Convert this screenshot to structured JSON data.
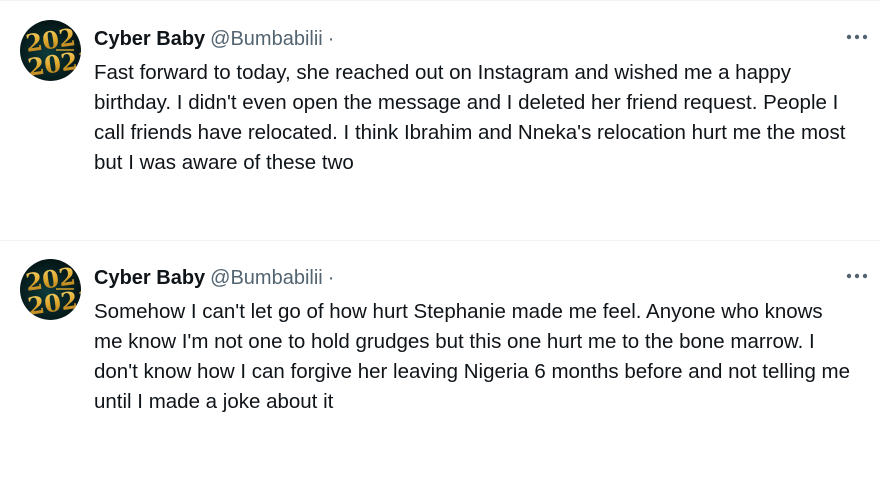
{
  "tweets": [
    {
      "author": {
        "display_name": "Cyber Baby",
        "handle": "@Bumbabilii",
        "separator": "·",
        "avatar_text": "2021"
      },
      "more_icon": "more-horizontal-icon",
      "text": "Fast forward to today, she reached out on Instagram and wished me a happy birthday. I didn't even open the message and I deleted her friend request. People I call friends have relocated. I think Ibrahim and Nneka's relocation hurt me the most but I was aware of these two"
    },
    {
      "author": {
        "display_name": "Cyber Baby",
        "handle": "@Bumbabilii",
        "separator": "·",
        "avatar_text": "2021"
      },
      "more_icon": "more-horizontal-icon",
      "text": "Somehow I can't let go of how hurt Stephanie made me feel. Anyone who knows me know I'm not one to hold grudges but this one hurt me to the bone marrow. I don't know how I can forgive her leaving Nigeria 6 months before and not telling me until I made a joke about it"
    }
  ],
  "colors": {
    "text_primary": "#0f1419",
    "text_secondary": "#536471",
    "divider": "#eff3f4",
    "avatar_gold": "#e9b73a"
  }
}
